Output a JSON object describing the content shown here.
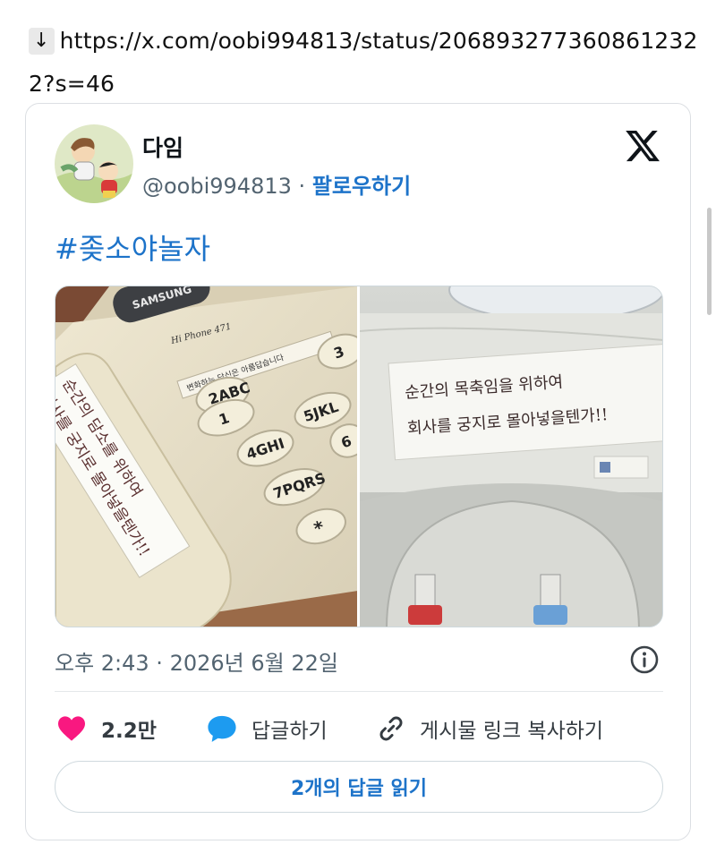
{
  "url": {
    "arrow": "↓",
    "text": "https://x.com/oobi994813/status/2068932773608612322?s=46"
  },
  "tweet": {
    "display_name": "다임",
    "handle": "@oobi994813",
    "separator": "·",
    "follow_label": "팔로우하기",
    "hashtag": "#좆소야놀자",
    "photos": [
      {
        "phone_brand": "SAMSUNG",
        "model": "Hi Phone 471",
        "phone_sticker": "변화하는 당신은 아름답습니다",
        "keys": [
          "1",
          "2ABC",
          "3",
          "4GHI",
          "5JKL",
          "6",
          "7PQRS",
          "*"
        ],
        "note_line1": "순간의 담소를 위하여",
        "note_line2": "회사를 궁지로 몰아넣을텐가!!"
      },
      {
        "note_line1": "순간의 목축임을 위하여",
        "note_line2": "회사를 궁지로 몰아넣을텐가!!"
      }
    ],
    "timestamp": "오후 2:43 · 2026년 6월 22일",
    "likes": "2.2만",
    "reply_label": "답글하기",
    "copy_link_label": "게시물 링크 복사하기",
    "read_replies_label": "2개의 답글 읽기"
  },
  "icons": {
    "x_logo": "x-logo-icon",
    "info": "info-icon",
    "like": "heart-icon",
    "reply": "speech-bubble-icon",
    "link": "link-icon"
  },
  "colors": {
    "link_blue": "#1d73c9",
    "like_pink": "#f91880",
    "reply_blue": "#1d9bf0"
  }
}
